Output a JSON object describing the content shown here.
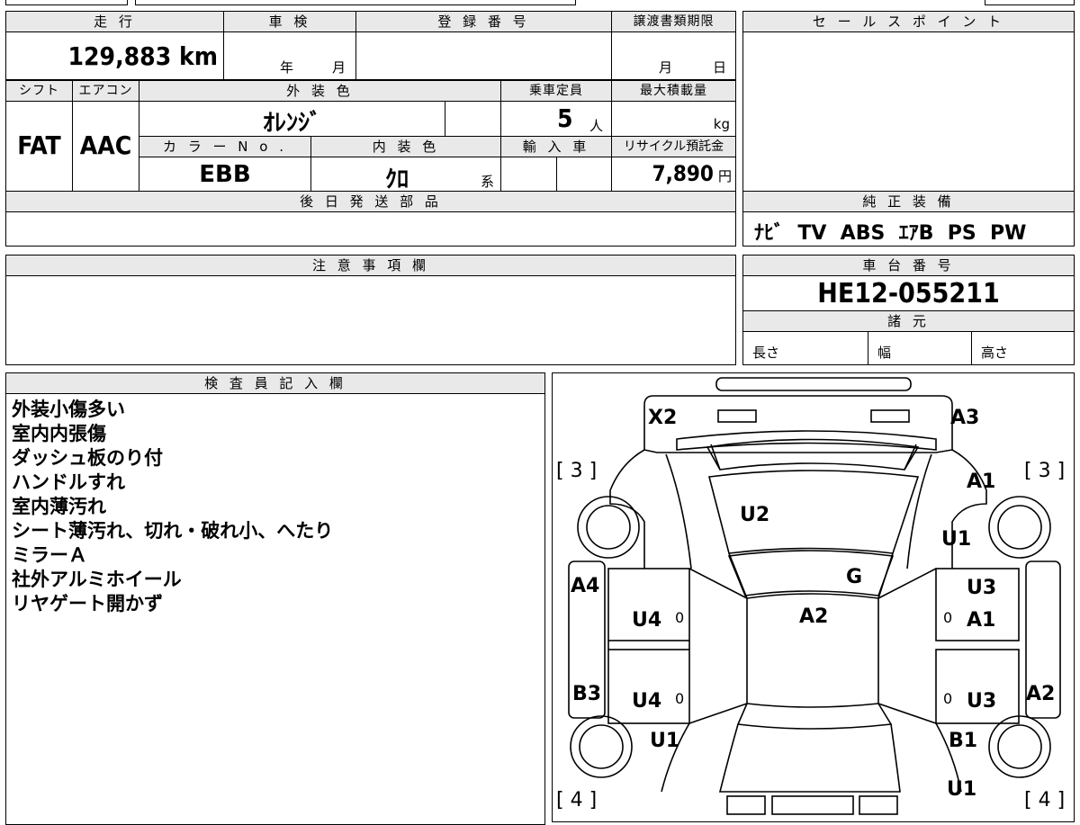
{
  "top": {
    "mileage_header": "走 行",
    "mileage_value": "129,883",
    "mileage_unit": "km",
    "inspection_header": "車 検",
    "inspection_year": "年",
    "inspection_month": "月",
    "registration_header": "登 録 番 号",
    "transfer_header": "譲渡書類期限",
    "transfer_month": "月",
    "transfer_day": "日",
    "shift_header": "シフト",
    "shift_value": "FAT",
    "aircon_header": "エアコン",
    "aircon_value": "AAC",
    "ext_color_header": "外 装 色",
    "ext_color_value": "ｵﾚﾝｼﾞ",
    "capacity_header": "乗車定員",
    "capacity_value": "5",
    "capacity_unit": "人",
    "max_load_header": "最大積載量",
    "max_load_unit": "kg",
    "color_no_header": "カ ラ ー N o .",
    "color_no_value": "EBB",
    "int_color_header": "内 装 色",
    "int_color_value": "ｸﾛ",
    "int_color_suffix": "系",
    "import_header": "輸 入 車",
    "recycle_header": "リサイクル預託金",
    "recycle_value": "7,890",
    "recycle_unit": "円",
    "later_parts_header": "後 日 発 送 部 品"
  },
  "sales_point": {
    "header": "セ ー ル ス ポ イ ン ト"
  },
  "equipment": {
    "header": "純 正 装 備",
    "value": "ﾅﾋﾞ  TV  ABS  ｴｱB  PS  PW"
  },
  "notes_section": {
    "header": "注 意 事 項 欄"
  },
  "chassis": {
    "header": "車 台 番 号",
    "value": "HE12-055211"
  },
  "specs": {
    "header": "諸 元",
    "length": "長さ",
    "width": "幅",
    "height": "高さ"
  },
  "inspector": {
    "header": "検 査 員 記 入 欄",
    "lines": [
      "外装小傷多い",
      "室内内張傷",
      "ダッシュ板のり付",
      "ハンドルすれ",
      "室内薄汚れ",
      "シート薄汚れ、切れ・破れ小、へたり",
      "ミラーＡ",
      "社外アルミホイール",
      "リヤゲート開かず"
    ]
  },
  "diagram": {
    "labels": {
      "x2": "X2",
      "a3": "A3",
      "tire_fl": "[ 3 ]",
      "tire_fr": "[ 3 ]",
      "a1_top": "A1",
      "u2": "U2",
      "u1_right": "U1",
      "g": "G",
      "a4": "A4",
      "u3_top": "U3",
      "u4_top": "U4",
      "zero1": "0",
      "a2_center": "A2",
      "zero2": "0",
      "a1_mid": "A1",
      "b3": "B3",
      "u4_bottom": "U4",
      "zero3": "0",
      "zero4": "0",
      "u3_bottom": "U3",
      "a2_right": "A2",
      "u1_left": "U1",
      "b1": "B1",
      "u1_bottom": "U1",
      "tire_rl": "[ 4 ]",
      "tire_rr": "[ 4 ]"
    }
  }
}
